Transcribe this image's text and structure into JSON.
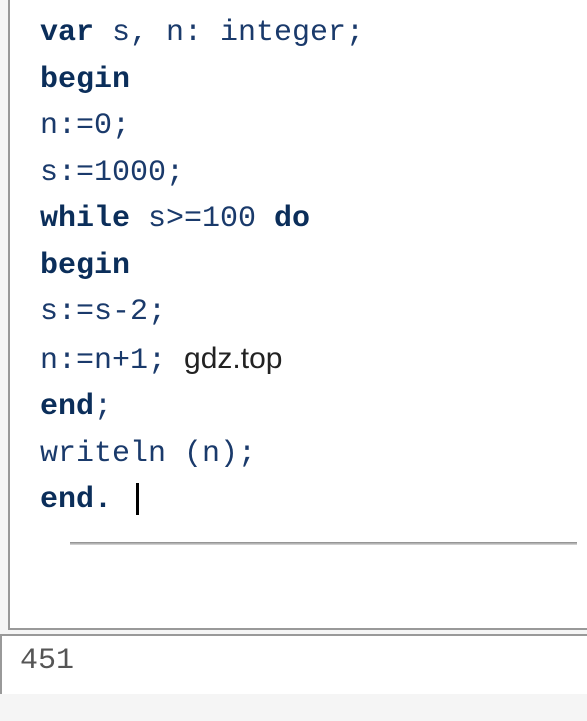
{
  "code": {
    "line1_kw1": "var",
    "line1_rest": " s, n: integer;",
    "line2_kw": "begin",
    "line3": "n:=0;",
    "line4": "s:=1000;",
    "line5_kw": "while",
    "line5_mid": " s>=100 ",
    "line5_kw2": "do",
    "line6_kw": "begin",
    "line7": "s:=s-2;",
    "line8a": "n:=n+1; ",
    "line8_watermark": "gdz.top",
    "line9_kw": "end",
    "line9_rest": ";",
    "line10": "writeln (n);",
    "line11_kw": "end.",
    "line11_rest": " "
  },
  "output": {
    "value": "451"
  }
}
